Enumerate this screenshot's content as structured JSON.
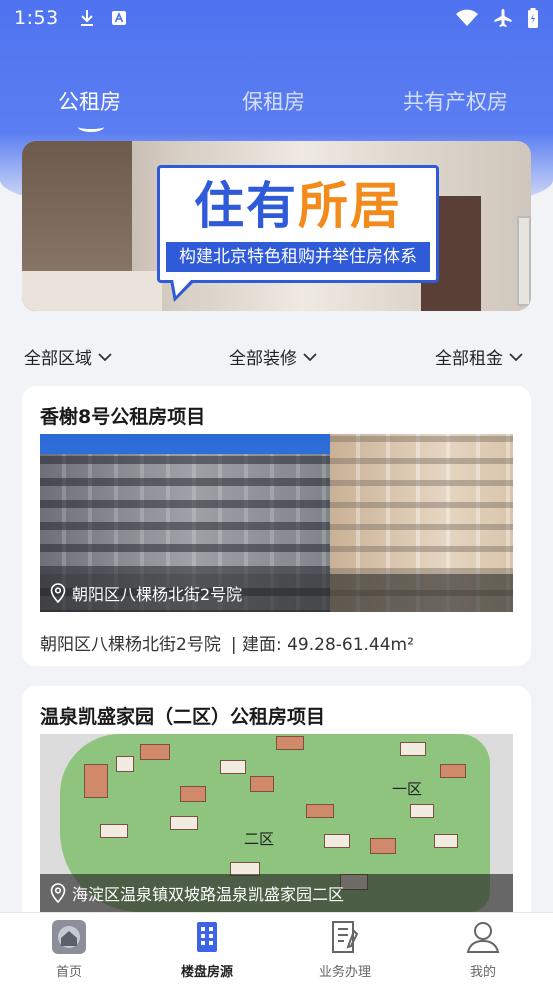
{
  "status_bar": {
    "time": "1:53",
    "left_icons": [
      "download-icon",
      "a-icon"
    ],
    "right_icons": [
      "wifi-icon",
      "airplane-icon",
      "battery-icon"
    ]
  },
  "colors": {
    "brand_blue": "#4f72f0",
    "banner_blue": "#2f5bd8",
    "banner_orange": "#f28a1c"
  },
  "tabs": [
    {
      "label": "公租房",
      "active": true
    },
    {
      "label": "保租房",
      "active": false
    },
    {
      "label": "共有产权房",
      "active": false
    }
  ],
  "banner": {
    "title_part1": "住有",
    "title_part2": "所居",
    "subtitle": "构建北京特色租购并举住房体系"
  },
  "filters": [
    {
      "label": "全部区域",
      "icon": "chevron-down-icon"
    },
    {
      "label": "全部装修",
      "icon": "chevron-down-icon"
    },
    {
      "label": "全部租金",
      "icon": "chevron-down-icon"
    }
  ],
  "listings": [
    {
      "title": "香榭8号公租房项目",
      "image_address": "朝阳区八棵杨北街2号院",
      "address": "朝阳区八棵杨北街2号院",
      "area": "| 建面: 49.28-61.44m²"
    },
    {
      "title": "温泉凯盛家园（二区）公租房项目",
      "image_address": "海淀区温泉镇双坡路温泉凯盛家园二区",
      "map_labels": [
        "二区",
        "一区"
      ]
    }
  ],
  "bottom_nav": [
    {
      "label": "首页",
      "icon": "home-icon",
      "active": false
    },
    {
      "label": "楼盘房源",
      "icon": "building-icon",
      "active": true
    },
    {
      "label": "业务办理",
      "icon": "document-icon",
      "active": false
    },
    {
      "label": "我的",
      "icon": "user-icon",
      "active": false
    }
  ]
}
